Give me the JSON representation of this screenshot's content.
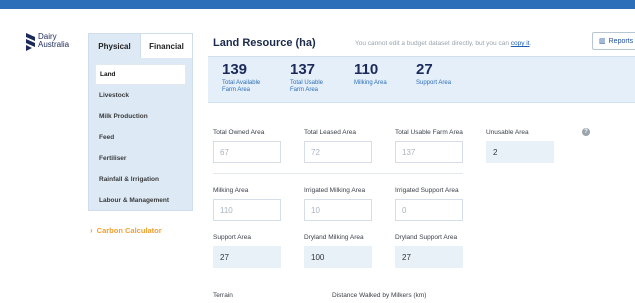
{
  "brand": {
    "line1": "Dairy",
    "line2": "Australia",
    "icon": "dairy-australia-logo"
  },
  "sidebar": {
    "tabs": [
      {
        "label": "Physical",
        "active": true
      },
      {
        "label": "Financial",
        "active": false
      }
    ],
    "items": [
      {
        "label": "Land",
        "active": true
      },
      {
        "label": "Livestock"
      },
      {
        "label": "Milk Production"
      },
      {
        "label": "Feed"
      },
      {
        "label": "Fertiliser"
      },
      {
        "label": "Rainfall & Irrigation"
      },
      {
        "label": "Labour & Management"
      }
    ],
    "carbon": "Carbon Calculator"
  },
  "header": {
    "title": "Land Resource (ha)",
    "notice_text": "You cannot edit a budget dataset directly, but you can",
    "notice_link": "copy it",
    "notice_end": ".",
    "reports_label": "Reports"
  },
  "summary": [
    {
      "value": "139",
      "label_1": "Total Available",
      "label_2": "Farm Area"
    },
    {
      "value": "137",
      "label_1": "Total Usable",
      "label_2": "Farm Area"
    },
    {
      "value": "110",
      "label_1": "Milking Area",
      "label_2": ""
    },
    {
      "value": "27",
      "label_1": "Support Area",
      "label_2": ""
    }
  ],
  "fields": {
    "total_owned": {
      "label": "Total Owned Area",
      "value": "67"
    },
    "total_leased": {
      "label": "Total Leased Area",
      "value": "72"
    },
    "total_usable": {
      "label": "Total Usable Farm Area",
      "value": "137"
    },
    "unusable": {
      "label": "Unusable Area",
      "value": "2"
    },
    "milking": {
      "label": "Milking Area",
      "value": "110"
    },
    "irrigated_milking": {
      "label": "Irrigated Milking Area",
      "value": "10"
    },
    "irrigated_support": {
      "label": "Irrigated Support Area",
      "value": "0"
    },
    "support": {
      "label": "Support Area",
      "value": "27"
    },
    "dryland_milking": {
      "label": "Dryland Milking Area",
      "value": "100"
    },
    "dryland_support": {
      "label": "Dryland Support Area",
      "value": "27"
    },
    "terrain": {
      "label": "Terrain"
    },
    "distance_walked": {
      "label": "Distance Walked by Milkers (km)"
    }
  },
  "colors": {
    "accent": "#2d6fb8",
    "carbon": "#f0a030",
    "summary_bg": "#e5eff9"
  }
}
